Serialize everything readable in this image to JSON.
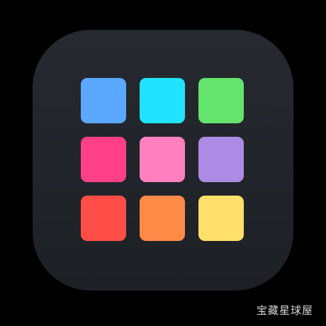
{
  "app_icon": {
    "name": "color-grid-app-icon",
    "background": "#22262b",
    "tiles": [
      {
        "name": "tile-blue",
        "color": "#5aa8ff"
      },
      {
        "name": "tile-cyan",
        "color": "#21e3ff"
      },
      {
        "name": "tile-green",
        "color": "#64e36d"
      },
      {
        "name": "tile-pink",
        "color": "#ff3f88"
      },
      {
        "name": "tile-light-pink",
        "color": "#ff7fbf"
      },
      {
        "name": "tile-lavender",
        "color": "#ad8be4"
      },
      {
        "name": "tile-red",
        "color": "#ff4d48"
      },
      {
        "name": "tile-orange",
        "color": "#ff8a47"
      },
      {
        "name": "tile-yellow",
        "color": "#ffe06a"
      }
    ]
  },
  "watermark": {
    "text": "宝藏星球屋"
  }
}
